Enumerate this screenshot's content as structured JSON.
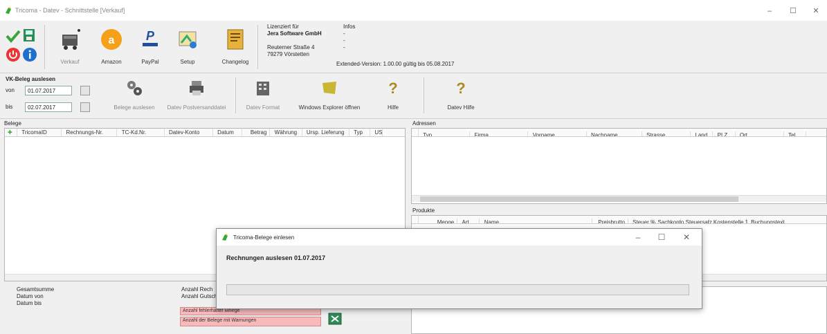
{
  "window": {
    "title": "Tricoma - Datev - Schnittstelle [Verkauf]",
    "min": "–",
    "max": "☐",
    "close": "✕"
  },
  "ribbon": {
    "buttons": [
      {
        "label": "Verkauf",
        "icon": "shopping-cart-icon"
      },
      {
        "label": "Amazon",
        "icon": "amazon-icon"
      },
      {
        "label": "PayPal",
        "icon": "paypal-icon"
      },
      {
        "label": "Setup",
        "icon": "setup-icon"
      },
      {
        "label": "Changelog",
        "icon": "changelog-icon"
      }
    ],
    "license_label": "Lizenziert für",
    "license_company": "Jera Software GmbH",
    "license_street": "Reuterner Straße 4",
    "license_city": "79279 Vörstetten",
    "info_label": "Infos",
    "info_line1": "-",
    "info_line2": "-",
    "info_line3": "-",
    "version": "Extended-Version: 1.00.00 gültig bis 05.08.2017"
  },
  "vk": {
    "title": "VK-Beleg auslesen",
    "von_label": "von",
    "von_value": "01.07.2017",
    "bis_label": "bis",
    "bis_value": "02.07.2017"
  },
  "toolbar": {
    "belege_auslesen": "Belege auslesen",
    "datev_postversand": "Datev Postversanddatei",
    "datev_format": "Datev Format",
    "windows_explorer": "Windows Explorer öffnen",
    "hilfe": "Hilfe",
    "datev_hilfe": "Datev Hilfe"
  },
  "belege": {
    "title": "Belege",
    "columns": [
      "TricomaID",
      "Rechnungs-Nr.",
      "TC-Kd.Nr.",
      "Datev-Konto",
      "Datum",
      "Betrag",
      "Währung",
      "Ursp. Lieferung",
      "Typ",
      "US"
    ]
  },
  "adressen": {
    "title": "Adressen",
    "columns": [
      "Typ",
      "Firma",
      "Vorname",
      "Nachname",
      "Strasse",
      "Land",
      "PLZ",
      "Ort",
      "Tel"
    ]
  },
  "produkte": {
    "title": "Produkte",
    "columns": [
      "Menge",
      "Art",
      "Name",
      "Preisbrutto",
      "Steuer %",
      "Sachkonto",
      "Steuersatz",
      "Kostenstelle 1",
      "Buchungstext"
    ]
  },
  "summary": {
    "gesamtsumme": "Gesamtsumme",
    "datum_von": "Datum von",
    "datum_bis": "Datum bis",
    "anzahl_rech": "Anzahl Rech",
    "anzahl_gut": "Anzahl Gutschr",
    "anzahl_fehler": "Anzahl fehlerhafter Belege",
    "anzahl_warnungen": "Anzahl der Belege mit Warnungen"
  },
  "dialog": {
    "title": "Tricoma-Belege einlesen",
    "message": "Rechnungen auslesen 01.07.2017",
    "progress": 0
  }
}
